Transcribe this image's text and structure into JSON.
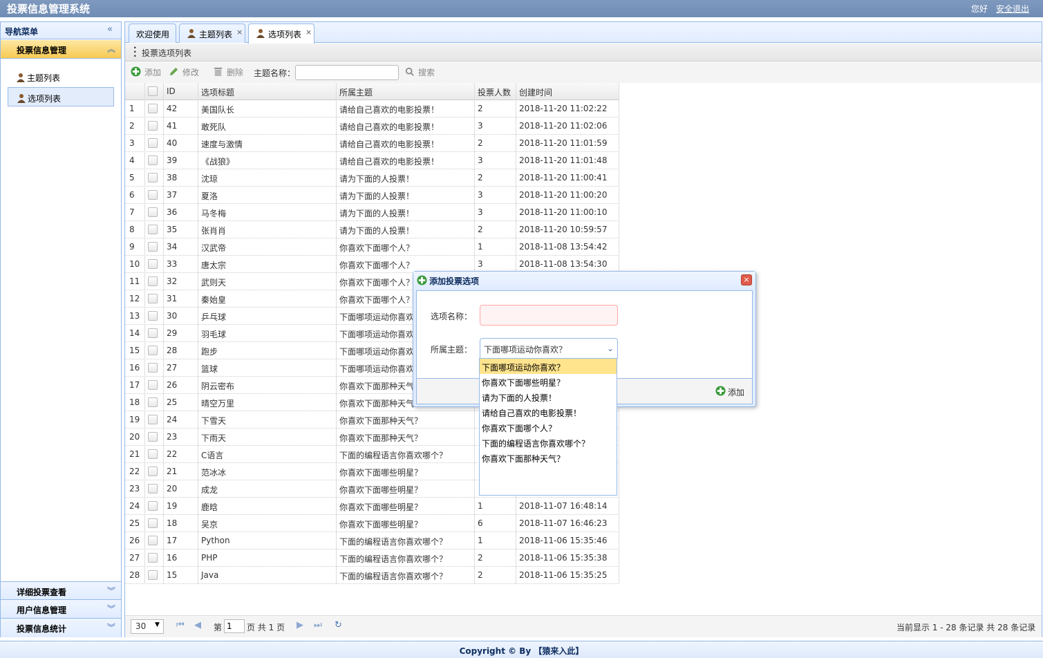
{
  "app": {
    "title": "投票信息管理系统",
    "hello": "您好",
    "logout": "安全退出"
  },
  "nav": {
    "title": "导航菜单",
    "sections": [
      {
        "label": "投票信息管理",
        "items": [
          {
            "label": "主题列表"
          },
          {
            "label": "选项列表"
          }
        ]
      },
      {
        "label": "详细投票查看"
      },
      {
        "label": "用户信息管理"
      },
      {
        "label": "投票信息统计"
      }
    ]
  },
  "tabs": [
    {
      "label": "欢迎使用"
    },
    {
      "label": "主题列表"
    },
    {
      "label": "选项列表"
    }
  ],
  "panel": {
    "title": "投票选项列表"
  },
  "toolbar": {
    "add": "添加",
    "edit": "修改",
    "delete": "删除",
    "search_label": "主题名称：",
    "search_button": "搜索",
    "search_value": ""
  },
  "grid": {
    "columns": [
      "ID",
      "选项标题",
      "所属主题",
      "投票人数",
      "创建时间"
    ],
    "rows": [
      {
        "n": "1",
        "id": "42",
        "title": "美国队长",
        "topic": "请给自己喜欢的电影投票！",
        "votes": "2",
        "time": "2018-11-20 11:02:22"
      },
      {
        "n": "2",
        "id": "41",
        "title": "敢死队",
        "topic": "请给自己喜欢的电影投票！",
        "votes": "3",
        "time": "2018-11-20 11:02:06"
      },
      {
        "n": "3",
        "id": "40",
        "title": "速度与激情",
        "topic": "请给自己喜欢的电影投票！",
        "votes": "2",
        "time": "2018-11-20 11:01:59"
      },
      {
        "n": "4",
        "id": "39",
        "title": "《战狼》",
        "topic": "请给自己喜欢的电影投票！",
        "votes": "3",
        "time": "2018-11-20 11:01:48"
      },
      {
        "n": "5",
        "id": "38",
        "title": "沈琼",
        "topic": "请为下面的人投票！",
        "votes": "2",
        "time": "2018-11-20 11:00:41"
      },
      {
        "n": "6",
        "id": "37",
        "title": "夏洛",
        "topic": "请为下面的人投票！",
        "votes": "3",
        "time": "2018-11-20 11:00:20"
      },
      {
        "n": "7",
        "id": "36",
        "title": "马冬梅",
        "topic": "请为下面的人投票！",
        "votes": "3",
        "time": "2018-11-20 11:00:10"
      },
      {
        "n": "8",
        "id": "35",
        "title": "张肖肖",
        "topic": "请为下面的人投票！",
        "votes": "2",
        "time": "2018-11-20 10:59:57"
      },
      {
        "n": "9",
        "id": "34",
        "title": "汉武帝",
        "topic": "你喜欢下面哪个人？",
        "votes": "1",
        "time": "2018-11-08 13:54:42"
      },
      {
        "n": "10",
        "id": "33",
        "title": "唐太宗",
        "topic": "你喜欢下面哪个人？",
        "votes": "3",
        "time": "2018-11-08 13:54:30"
      },
      {
        "n": "11",
        "id": "32",
        "title": "武则天",
        "topic": "你喜欢下面哪个人？",
        "votes": "",
        "time": ""
      },
      {
        "n": "12",
        "id": "31",
        "title": "秦始皇",
        "topic": "你喜欢下面哪个人？",
        "votes": "",
        "time": ""
      },
      {
        "n": "13",
        "id": "30",
        "title": "乒乓球",
        "topic": "下面哪项运动你喜欢",
        "votes": "",
        "time": ""
      },
      {
        "n": "14",
        "id": "29",
        "title": "羽毛球",
        "topic": "下面哪项运动你喜欢",
        "votes": "",
        "time": ""
      },
      {
        "n": "15",
        "id": "28",
        "title": "跑步",
        "topic": "下面哪项运动你喜欢",
        "votes": "",
        "time": ""
      },
      {
        "n": "16",
        "id": "27",
        "title": "篮球",
        "topic": "下面哪项运动你喜欢",
        "votes": "",
        "time": ""
      },
      {
        "n": "17",
        "id": "26",
        "title": "阴云密布",
        "topic": "你喜欢下面那种天气",
        "votes": "",
        "time": ""
      },
      {
        "n": "18",
        "id": "25",
        "title": "晴空万里",
        "topic": "你喜欢下面那种天气",
        "votes": "",
        "time": ""
      },
      {
        "n": "19",
        "id": "24",
        "title": "下雪天",
        "topic": "你喜欢下面那种天气？",
        "votes": "",
        "time": ""
      },
      {
        "n": "20",
        "id": "23",
        "title": "下雨天",
        "topic": "你喜欢下面那种天气？",
        "votes": "",
        "time": ""
      },
      {
        "n": "21",
        "id": "22",
        "title": "C语言",
        "topic": "下面的编程语言你喜欢哪个？",
        "votes": "",
        "time": ""
      },
      {
        "n": "22",
        "id": "21",
        "title": "范冰冰",
        "topic": "你喜欢下面哪些明星？",
        "votes": "",
        "time": ""
      },
      {
        "n": "23",
        "id": "20",
        "title": "成龙",
        "topic": "你喜欢下面哪些明星？",
        "votes": "",
        "time": ""
      },
      {
        "n": "24",
        "id": "19",
        "title": "鹿晗",
        "topic": "你喜欢下面哪些明星？",
        "votes": "1",
        "time": "2018-11-07 16:48:14"
      },
      {
        "n": "25",
        "id": "18",
        "title": "吴京",
        "topic": "你喜欢下面哪些明星？",
        "votes": "6",
        "time": "2018-11-07 16:46:23"
      },
      {
        "n": "26",
        "id": "17",
        "title": "Python",
        "topic": "下面的编程语言你喜欢哪个？",
        "votes": "1",
        "time": "2018-11-06 15:35:46"
      },
      {
        "n": "27",
        "id": "16",
        "title": "PHP",
        "topic": "下面的编程语言你喜欢哪个？",
        "votes": "2",
        "time": "2018-11-06 15:35:38"
      },
      {
        "n": "28",
        "id": "15",
        "title": "Java",
        "topic": "下面的编程语言你喜欢哪个？",
        "votes": "2",
        "time": "2018-11-06 15:35:25"
      }
    ]
  },
  "pager": {
    "page_size": "30",
    "page_prefix": "第",
    "page_value": "1",
    "page_suffix": "页 共 1 页",
    "info": "当前显示 1 - 28 条记录 共 28 条记录"
  },
  "dialog": {
    "title": "添加投票选项",
    "name_label": "选项名称：",
    "name_value": "",
    "topic_label": "所属主题：",
    "topic_value": "下面哪项运动你喜欢？",
    "options": [
      "下面哪项运动你喜欢？",
      "你喜欢下面哪些明星？",
      "请为下面的人投票！",
      "请给自己喜欢的电影投票！",
      "你喜欢下面哪个人？",
      "下面的编程语言你喜欢哪个？",
      "你喜欢下面那种天气？"
    ],
    "add_button": "添加"
  },
  "footer": {
    "copyright": "Copyright © By 【猿来入此】"
  },
  "colors": {
    "accent": "#95b8e7",
    "header_bg": "#7f99be",
    "selected_menu": "#fbd36b"
  }
}
